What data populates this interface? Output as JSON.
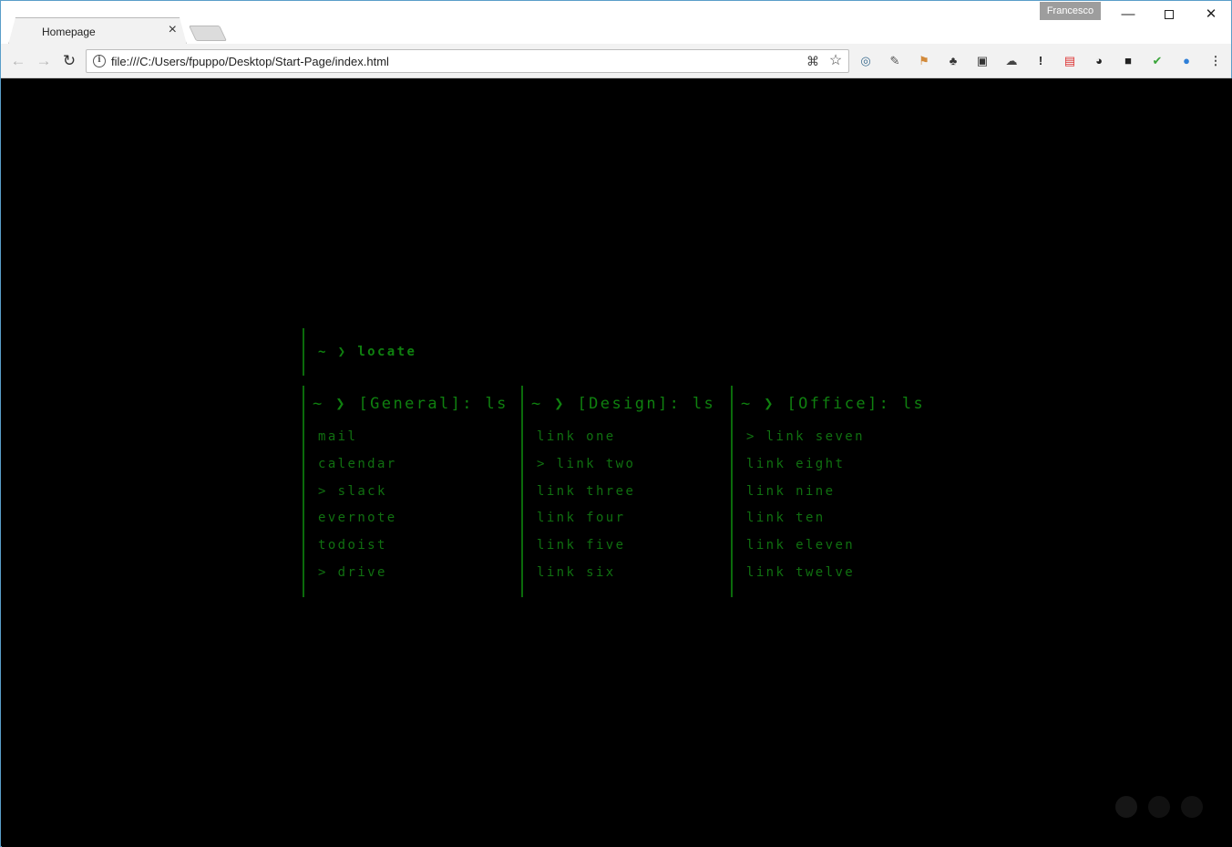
{
  "browser": {
    "tab_title": "Homepage",
    "tab_close": "×",
    "profile_name": "Francesco",
    "window_controls": {
      "minimize": "—",
      "close": "✕"
    },
    "url": "file:///C:/Users/fpuppo/Desktop/Start-Page/index.html",
    "nav": {
      "back": "←",
      "forward": "→",
      "reload": "↻"
    },
    "extensions": [
      "ring-icon",
      "eyedropper-icon",
      "bookmark-tag-icon",
      "evernote-icon",
      "pocket-icon",
      "cloud-icon",
      "alert-icon",
      "calendar-icon",
      "panda-icon",
      "todoist-icon",
      "check-icon",
      "globe-icon",
      "menu-icon"
    ]
  },
  "page": {
    "colors": {
      "background": "#000000",
      "text": "#0d7a0d",
      "rule": "#0b6b0b"
    },
    "locate": {
      "prompt": "~ ❯ locate"
    },
    "columns": [
      {
        "header": "~ ❯ [General]: ls",
        "links": [
          "mail",
          "calendar",
          "> slack",
          "evernote",
          "todoist",
          "> drive"
        ]
      },
      {
        "header": "~ ❯ [Design]: ls",
        "links": [
          "link one",
          "> link two",
          "link three",
          "link four",
          "link five",
          "link six"
        ]
      },
      {
        "header": "~ ❯ [Office]: ls",
        "links": [
          "> link seven",
          "link eight",
          "link nine",
          "link ten",
          "link eleven",
          "link twelve"
        ]
      }
    ]
  }
}
